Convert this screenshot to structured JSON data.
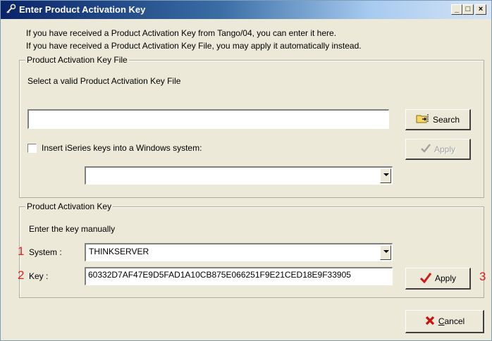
{
  "window": {
    "title": "Enter Product Activation Key",
    "min_glyph": "_",
    "max_glyph": "□",
    "close_glyph": "×"
  },
  "intro": {
    "line1": "If you have received a Product Activation Key from Tango/04, you can enter it here.",
    "line2": "If you have received a Product Activation Key File, you may apply it automatically instead."
  },
  "file_group": {
    "label": "Product Activation Key File",
    "select_label": "Select a valid Product Activation Key File",
    "file_path": "",
    "search_label": "Search",
    "checkbox_label": "Insert iSeries keys into a Windows system:",
    "checkbox_checked": false,
    "system_combo_value": "",
    "apply_label": "Apply"
  },
  "key_group": {
    "label": "Product Activation Key",
    "manual_label": "Enter the key manually",
    "system_label": "System :",
    "system_value": "THINKSERVER",
    "key_label": "Key :",
    "key_value": "60332D7AF47E9D5FAD1A10CB875E066251F9E21CED18E9F33905",
    "apply_label": "Apply"
  },
  "cancel_label": "Cancel",
  "annotations": {
    "n1": "1",
    "n2": "2",
    "n3": "3"
  },
  "colors": {
    "annotation": "#e02020",
    "check": "#d01818",
    "cancel_x": "#cc1010"
  }
}
